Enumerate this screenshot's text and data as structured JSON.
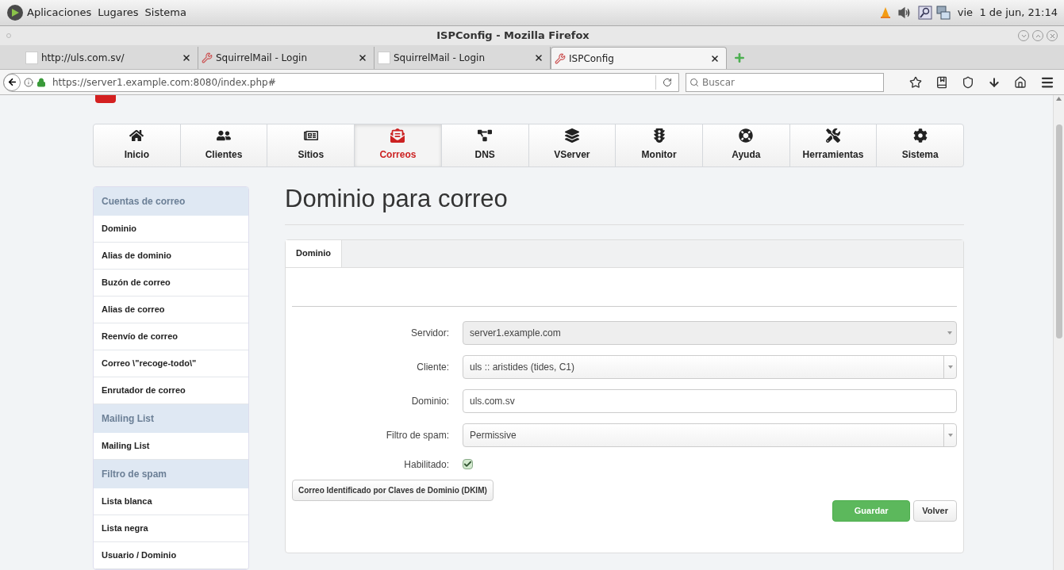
{
  "desktop_bar": {
    "menus": [
      "Aplicaciones",
      "Lugares",
      "Sistema"
    ],
    "clock": "vie  1 de jun, 21:14"
  },
  "window": {
    "title": "ISPConfig - Mozilla Firefox"
  },
  "browser_tabs": [
    {
      "label": "http://uls.com.sv/",
      "selected": false,
      "kind": "blank"
    },
    {
      "label": "SquirrelMail - Login",
      "selected": false,
      "kind": "tools"
    },
    {
      "label": "SquirrelMail - Login",
      "selected": false,
      "kind": "blank"
    },
    {
      "label": "ISPConfig",
      "selected": true,
      "kind": "tools"
    }
  ],
  "address_bar": {
    "url": "https://server1.example.com:8080/index.php#"
  },
  "search": {
    "placeholder": "Buscar"
  },
  "main_nav": [
    {
      "label": "Inicio",
      "selected": false
    },
    {
      "label": "Clientes",
      "selected": false
    },
    {
      "label": "Sitios",
      "selected": false
    },
    {
      "label": "Correos",
      "selected": true
    },
    {
      "label": "DNS",
      "selected": false
    },
    {
      "label": "VServer",
      "selected": false
    },
    {
      "label": "Monitor",
      "selected": false
    },
    {
      "label": "Ayuda",
      "selected": false
    },
    {
      "label": "Herramientas",
      "selected": false
    },
    {
      "label": "Sistema",
      "selected": false
    }
  ],
  "sidebar": {
    "sections": [
      {
        "title": "Cuentas de correo",
        "items": [
          "Dominio",
          "Alias de dominio",
          "Buzón de correo",
          "Alias de correo",
          "Reenvío de correo",
          "Correo \\\"recoge-todo\\\"",
          "Enrutador de correo"
        ]
      },
      {
        "title": "Mailing List",
        "items": [
          "Mailing List"
        ]
      },
      {
        "title": "Filtro de spam",
        "items": [
          "Lista blanca",
          "Lista negra",
          "Usuario / Dominio"
        ]
      }
    ]
  },
  "page_title": "Dominio para correo",
  "form_tabs": [
    {
      "label": "Dominio",
      "selected": true
    }
  ],
  "fields": [
    {
      "label": "Servidor:",
      "kind": "select",
      "value": "server1.example.com",
      "disabled": true
    },
    {
      "label": "Cliente:",
      "kind": "select",
      "value": "uls :: aristides (tides, C1)",
      "disabled": false
    },
    {
      "label": "Dominio:",
      "kind": "text",
      "value": "uls.com.sv"
    },
    {
      "label": "Filtro de spam:",
      "kind": "select",
      "value": "Permissive",
      "disabled": false
    },
    {
      "label": "Habilitado:",
      "kind": "checkbox",
      "checked": true
    }
  ],
  "dkim_button": "Correo Identificado por Claves de Dominio (DKIM)",
  "buttons": [
    {
      "label": "Guardar",
      "kind": "primary"
    },
    {
      "label": "Volver",
      "kind": "default"
    }
  ]
}
